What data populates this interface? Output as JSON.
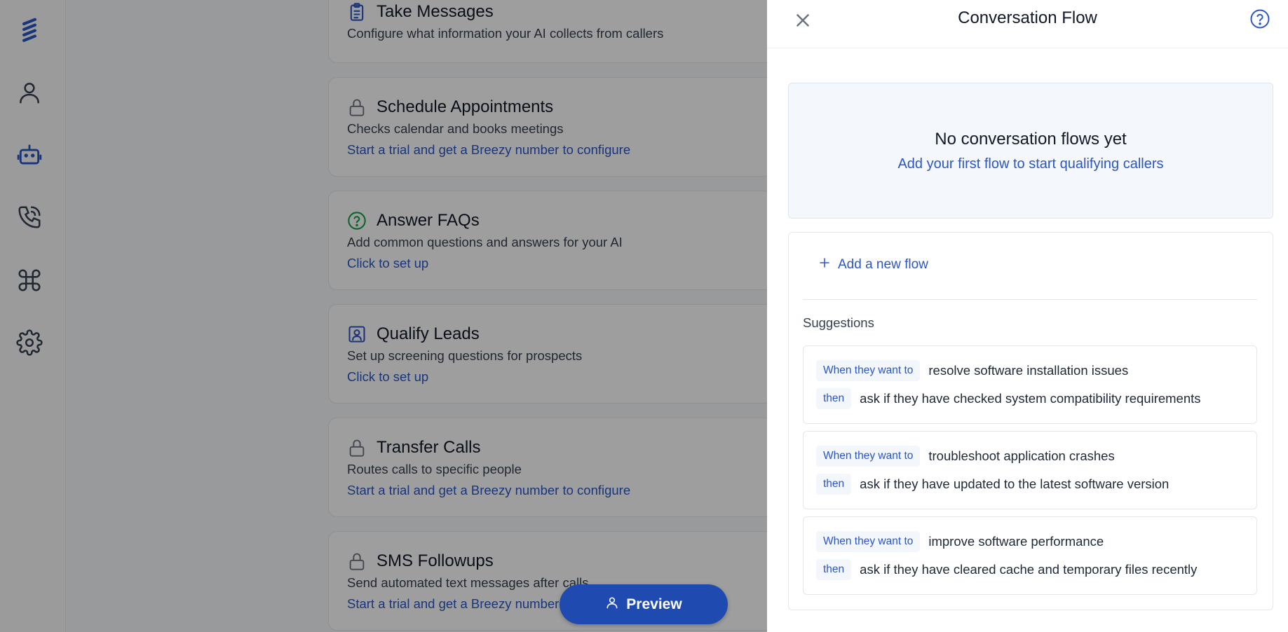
{
  "nav": {
    "items": [
      {
        "icon": "logo-icon"
      },
      {
        "icon": "user-icon"
      },
      {
        "icon": "robot-icon"
      },
      {
        "icon": "phone-icon"
      },
      {
        "icon": "command-icon"
      },
      {
        "icon": "settings-gear-icon"
      }
    ],
    "active_color": "#2a56c6"
  },
  "features": [
    {
      "title": "Take Messages",
      "desc": "Configure what information your AI collects from callers",
      "link": "",
      "icon": "clipboard-icon"
    },
    {
      "title": "Schedule Appointments",
      "desc": "Checks calendar and books meetings",
      "link": "Start a trial and get a Breezy number to configure",
      "icon": "lock-icon"
    },
    {
      "title": "Answer FAQs",
      "desc": "Add common questions and answers for your AI",
      "link": "Click to set up",
      "icon": "question-circle-icon"
    },
    {
      "title": "Qualify Leads",
      "desc": "Set up screening questions for prospects",
      "link": "Click to set up",
      "icon": "contact-icon"
    },
    {
      "title": "Transfer Calls",
      "desc": "Routes calls to specific people",
      "link": "Start a trial and get a Breezy number to configure",
      "icon": "lock-icon"
    },
    {
      "title": "SMS Followups",
      "desc": "Send automated text messages after calls",
      "link": "Start a trial and get a Breezy number to configure",
      "icon": "lock-icon"
    }
  ],
  "preview_button": {
    "label": "Preview"
  },
  "panel": {
    "title": "Conversation Flow",
    "empty_title": "No conversation flows yet",
    "empty_subtitle": "Add your first flow to start qualifying callers",
    "add_flow_label": "Add a new flow",
    "suggestions_label": "Suggestions",
    "suggestions": [
      {
        "when_label": "When they want to",
        "when_text": "resolve software installation issues",
        "then_label": "then",
        "then_text": "ask if they have checked system compatibility requirements"
      },
      {
        "when_label": "When they want to",
        "when_text": "troubleshoot application crashes",
        "then_label": "then",
        "then_text": "ask if they have updated to the latest software version"
      },
      {
        "when_label": "When they want to",
        "when_text": "improve software performance",
        "then_label": "then",
        "then_text": "ask if they have cleared cache and temporary files recently"
      }
    ]
  },
  "colors": {
    "accent": "#2a56c6",
    "preview_bg": "#1f4bb0",
    "faq_icon": "#16a34a"
  }
}
